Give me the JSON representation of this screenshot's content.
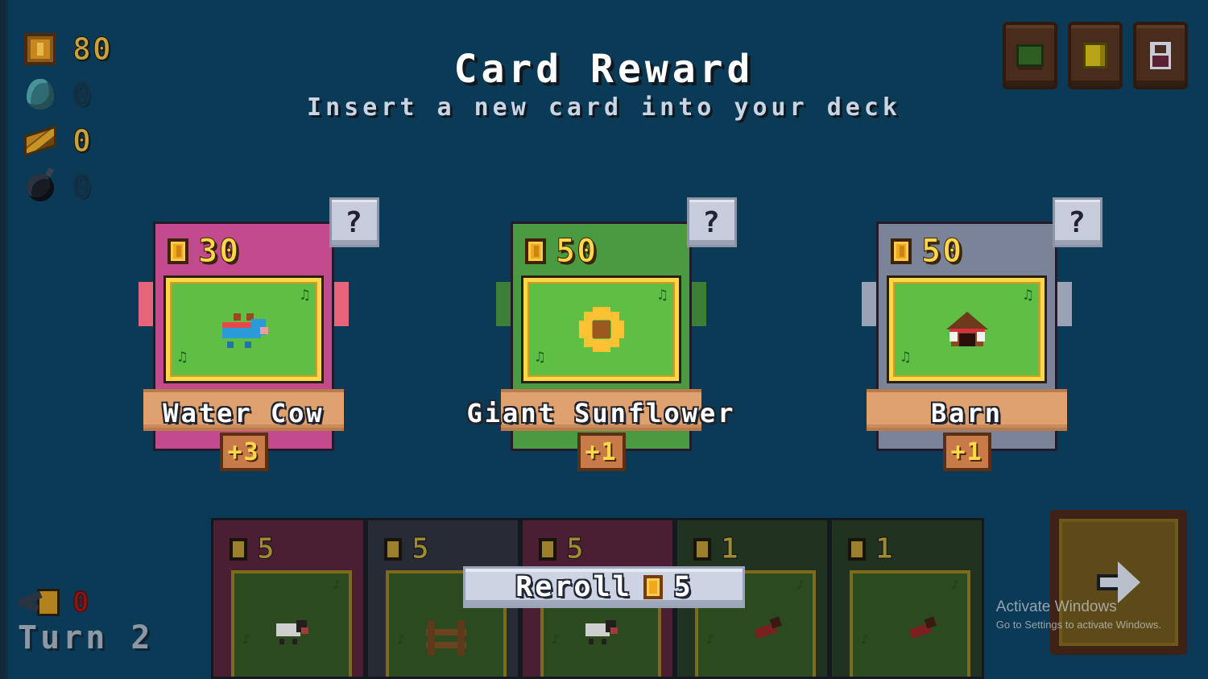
{
  "header": {
    "title": "Card Reward",
    "subtitle": "Insert a new card into your deck"
  },
  "resources": [
    {
      "icon": "coin-icon",
      "value": "80"
    },
    {
      "icon": "water-icon",
      "value": "0"
    },
    {
      "icon": "wood-icon",
      "value": "0"
    },
    {
      "icon": "bomb-icon",
      "value": "0"
    }
  ],
  "top_buttons": [
    {
      "name": "deck-button",
      "icon": "deck-icon"
    },
    {
      "name": "gold-button",
      "icon": "gold-icon"
    },
    {
      "name": "potion-button",
      "icon": "potion-icon"
    }
  ],
  "reward_cards": [
    {
      "name": "Water Cow",
      "cost": "30",
      "bonus": "+3",
      "frame_color": "#c44a8e",
      "ear_color": "#e8647a",
      "info_badge": "?",
      "sprite": "cow-sprite",
      "grass_top": "♫",
      "grass_bottom": "♫"
    },
    {
      "name": "Giant Sunflower",
      "cost": "50",
      "bonus": "+1",
      "frame_color": "#4a9a42",
      "ear_color": "#3c8038",
      "info_badge": "?",
      "sprite": "sunflower-sprite",
      "grass_top": "♫",
      "grass_bottom": "♫"
    },
    {
      "name": "Barn",
      "cost": "50",
      "bonus": "+1",
      "frame_color": "#7a8398",
      "ear_color": "#9aa3b6",
      "info_badge": "?",
      "sprite": "barn-sprite",
      "grass_top": "♫",
      "grass_bottom": "♫"
    }
  ],
  "hand_cards": [
    {
      "cost": "5",
      "frame_color": "#4a1f33",
      "sprite": "sheep-sprite"
    },
    {
      "cost": "5",
      "frame_color": "#272b36",
      "sprite": "fence-sprite"
    },
    {
      "cost": "5",
      "frame_color": "#4a1f33",
      "sprite": "sheep-sprite"
    },
    {
      "cost": "1",
      "frame_color": "#1f3320",
      "sprite": "crop-sprite"
    },
    {
      "cost": "1",
      "frame_color": "#1f3320",
      "sprite": "crop-sprite"
    }
  ],
  "reroll": {
    "label": "Reroll",
    "cost": "5"
  },
  "turn": {
    "tool_value": "0",
    "label": "Turn 2"
  },
  "end_turn": {
    "icon": "arrow-right-icon"
  },
  "watermark": {
    "line1": "Activate Windows",
    "line2": "Go to Settings to activate Windows."
  },
  "colors": {
    "background": "#0a3a55",
    "gold": "#ffd84a",
    "art_green": "#5fbf44",
    "banner_tan": "#e0a170"
  }
}
